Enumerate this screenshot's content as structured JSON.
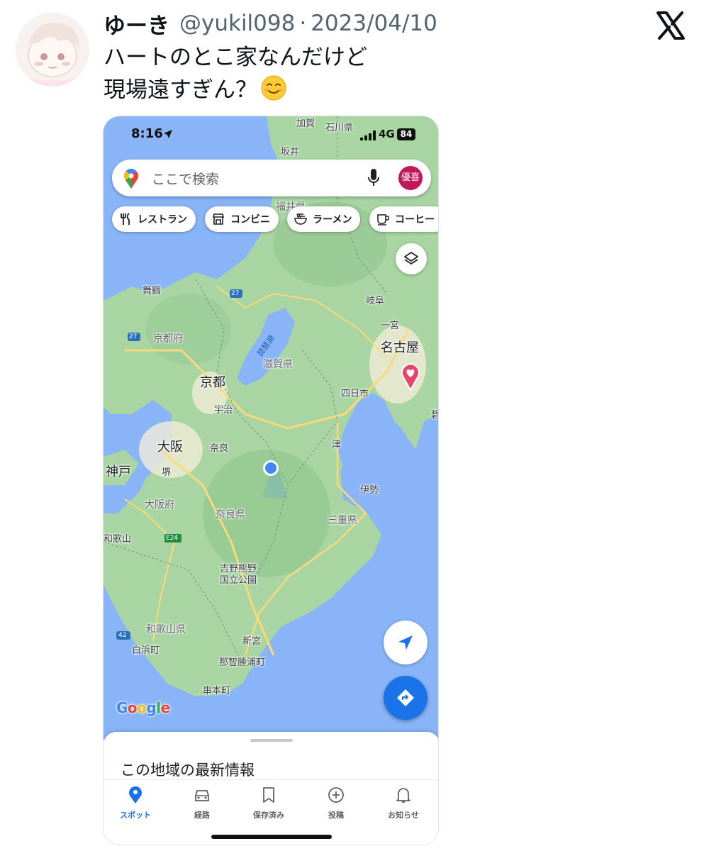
{
  "tweet": {
    "display_name": "ゆーき",
    "handle": "@yukil098",
    "separator": "·",
    "date": "2023/04/10",
    "text_line1": "ハートのとこ家なんだけど",
    "text_line2": "現場遠すぎん？",
    "emoji": "smiling-face-emoji"
  },
  "phone": {
    "status": {
      "time": "8:16",
      "network": "4G",
      "battery": "84"
    },
    "search": {
      "placeholder": "ここで検索",
      "avatar_text": "優喜"
    },
    "chips": [
      {
        "label": "レストラン",
        "icon": "restaurant-icon"
      },
      {
        "label": "コンビニ",
        "icon": "store-icon"
      },
      {
        "label": "ラーメン",
        "icon": "ramen-icon"
      },
      {
        "label": "コーヒー",
        "icon": "coffee-icon"
      }
    ],
    "map_labels": {
      "kaga": "加賀",
      "ishikawa": "石川県",
      "sakai_fukui": "坂井",
      "fukui": "福井県",
      "maizuru": "舞鶴",
      "kyoto_pref": "京都府",
      "biwako": "琵琶湖",
      "shiga": "滋賀県",
      "gifu": "岐阜",
      "ichinomiya": "一宮",
      "nagoya": "名古屋",
      "yokkaichi": "四日市",
      "kyoto": "京都",
      "uji": "宇治",
      "osaka": "大阪",
      "nara": "奈良",
      "kobe": "神戸",
      "sakai": "堺",
      "tsu": "津",
      "osaka_pref": "大阪府",
      "ise": "伊勢",
      "nara_pref": "奈良県",
      "mie": "三重県",
      "wakayama": "和歌山",
      "yoshino1": "吉野熊野",
      "yoshino2": "国立公園",
      "wakayama_pref": "和歌山県",
      "shingu": "新宮",
      "shirahama": "白浜町",
      "nachikatsuura": "那智勝浦町",
      "kushimoto": "串本町",
      "hekinan_edge": "碧",
      "route27a": "27",
      "route27b": "27",
      "route42": "42",
      "e24": "E24"
    },
    "google_logo": "Google",
    "sheet_title": "この地域の最新情報",
    "nav": [
      {
        "label": "スポット",
        "icon": "pin-icon",
        "active": true
      },
      {
        "label": "経路",
        "icon": "car-icon",
        "active": false
      },
      {
        "label": "保存済み",
        "icon": "bookmark-icon",
        "active": false
      },
      {
        "label": "投稿",
        "icon": "plus-circle-icon",
        "active": false
      },
      {
        "label": "お知らせ",
        "icon": "bell-icon",
        "active": false
      }
    ]
  },
  "colors": {
    "accent": "#1a73e8",
    "heart_pin": "#e8446d",
    "sea": "#8ab4f8",
    "land": "#a8d5a2"
  }
}
